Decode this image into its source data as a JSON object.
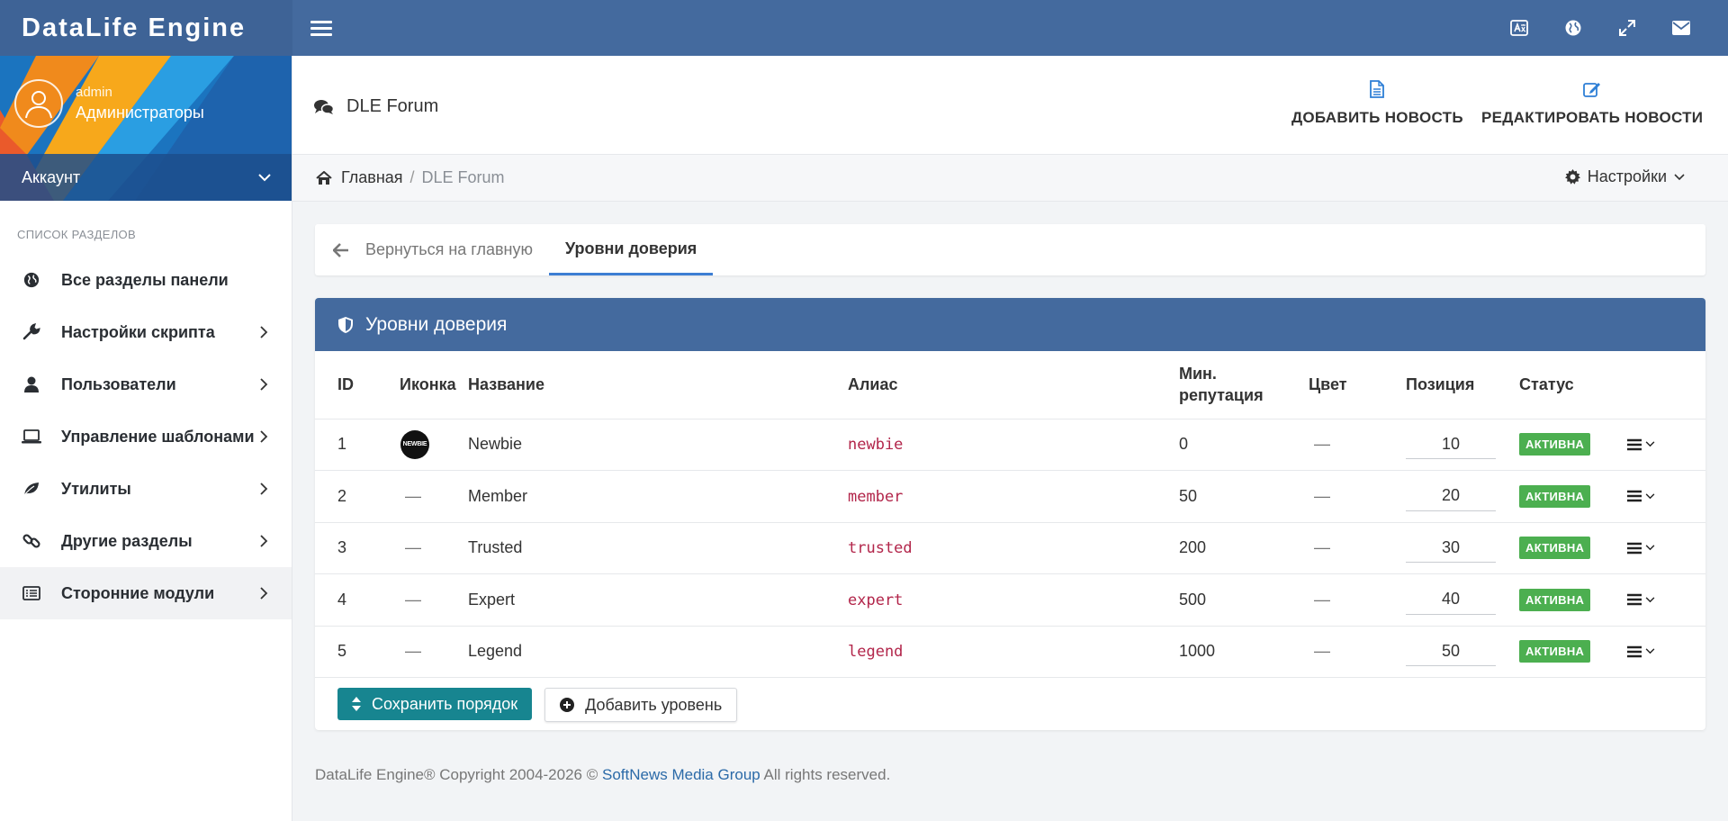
{
  "app": {
    "brand": "DataLife Engine"
  },
  "user": {
    "name": "admin",
    "group": "Администраторы",
    "account_label": "Аккаунт"
  },
  "sidebar": {
    "section_title": "СПИСОК РАЗДЕЛОВ",
    "items": [
      {
        "label": "Все разделы панели",
        "icon": "globe-icon"
      },
      {
        "label": "Настройки скрипта",
        "icon": "wrench-icon"
      },
      {
        "label": "Пользователи",
        "icon": "user-icon"
      },
      {
        "label": "Управление шаблонами",
        "icon": "laptop-icon"
      },
      {
        "label": "Утилиты",
        "icon": "leaf-icon"
      },
      {
        "label": "Другие разделы",
        "icon": "link-icon"
      },
      {
        "label": "Сторонние модули",
        "icon": "modules-icon"
      }
    ]
  },
  "header": {
    "title": "DLE Forum",
    "add_news": "ДОБАВИТЬ НОВОСТЬ",
    "edit_news": "РЕДАКТИРОВАТЬ НОВОСТИ"
  },
  "breadcrumb": {
    "home": "Главная",
    "current": "DLE Forum",
    "settings": "Настройки"
  },
  "tabs": {
    "back": "Вернуться на главную",
    "active": "Уровни доверия"
  },
  "panel": {
    "title": "Уровни доверия",
    "columns": {
      "id": "ID",
      "icon": "Иконка",
      "name": "Название",
      "alias": "Алиас",
      "min_rep_1": "Мин.",
      "min_rep_2": "репутация",
      "color": "Цвет",
      "position": "Позиция",
      "status": "Статус"
    },
    "rows": [
      {
        "id": "1",
        "icon": "NEWBIE",
        "name": "Newbie",
        "alias": "newbie",
        "rep": "0",
        "color": "—",
        "position": "10",
        "status": "АКТИВНА"
      },
      {
        "id": "2",
        "icon": "—",
        "name": "Member",
        "alias": "member",
        "rep": "50",
        "color": "—",
        "position": "20",
        "status": "АКТИВНА"
      },
      {
        "id": "3",
        "icon": "—",
        "name": "Trusted",
        "alias": "trusted",
        "rep": "200",
        "color": "—",
        "position": "30",
        "status": "АКТИВНА"
      },
      {
        "id": "4",
        "icon": "—",
        "name": "Expert",
        "alias": "expert",
        "rep": "500",
        "color": "—",
        "position": "40",
        "status": "АКТИВНА"
      },
      {
        "id": "5",
        "icon": "—",
        "name": "Legend",
        "alias": "legend",
        "rep": "1000",
        "color": "—",
        "position": "50",
        "status": "АКТИВНА"
      }
    ],
    "save_order": "Сохранить порядок",
    "add_level": "Добавить уровень"
  },
  "footer": {
    "prefix": "DataLife Engine® Copyright 2004-2026 © ",
    "company": "SoftNews Media Group",
    "suffix": " All rights reserved."
  },
  "colors": {
    "topbar": "#446a9e",
    "accent_tab": "#3d7ed3",
    "save_button": "#178590",
    "status_badge": "#4caf50",
    "alias": "#b2254a"
  }
}
